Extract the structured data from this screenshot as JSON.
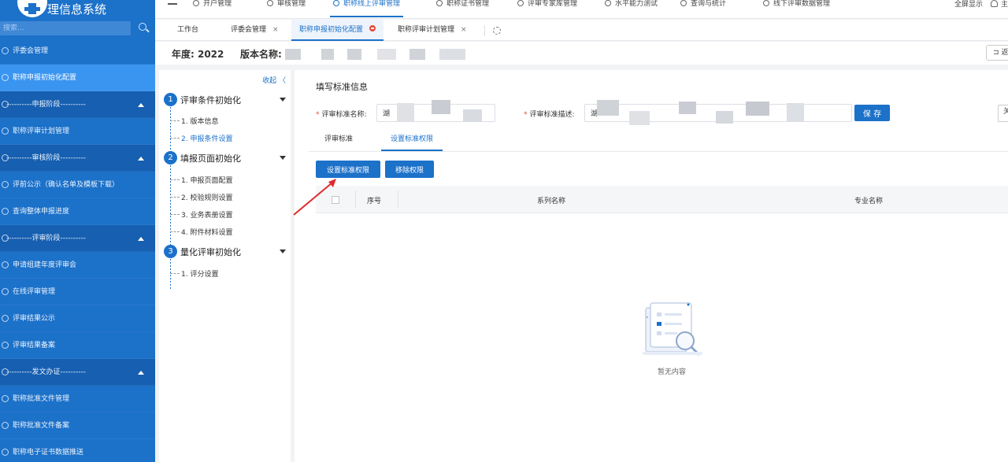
{
  "app": {
    "title": "理信息系统"
  },
  "sidebar": {
    "search_placeholder": "搜索...",
    "items": [
      {
        "label": "评委会管理",
        "type": "item",
        "active": false
      },
      {
        "label": "职称申报初始化配置",
        "type": "item",
        "active": true
      },
      {
        "label": "----------申报阶段----------",
        "type": "group"
      },
      {
        "label": "职称评审计划管理",
        "type": "item",
        "active": false
      },
      {
        "label": "----------审核阶段----------",
        "type": "group"
      },
      {
        "label": "评前公示（确认名单及模板下载）",
        "type": "item",
        "active": false
      },
      {
        "label": "查询整体申报进度",
        "type": "item",
        "active": false
      },
      {
        "label": "----------评审阶段----------",
        "type": "group"
      },
      {
        "label": "申请组建年度评审会",
        "type": "item",
        "active": false
      },
      {
        "label": "在线评审管理",
        "type": "item",
        "active": false
      },
      {
        "label": "评审结果公示",
        "type": "item",
        "active": false
      },
      {
        "label": "评审结果备案",
        "type": "item",
        "active": false
      },
      {
        "label": "----------发文办证----------",
        "type": "group"
      },
      {
        "label": "职称批准文件管理",
        "type": "item",
        "active": false
      },
      {
        "label": "职称批准文件备案",
        "type": "item",
        "active": false
      },
      {
        "label": "职称电子证书数据推送",
        "type": "item",
        "active": false
      }
    ]
  },
  "topnav": {
    "items": [
      {
        "label": "开户管理",
        "active": false
      },
      {
        "label": "审核管理",
        "active": false
      },
      {
        "label": "职称线上评审管理",
        "active": true
      },
      {
        "label": "职称证书管理",
        "active": false
      },
      {
        "label": "评审专家库管理",
        "active": false
      },
      {
        "label": "水平能力测试",
        "active": false
      },
      {
        "label": "查询与统计",
        "active": false
      },
      {
        "label": "线下评审数据管理",
        "active": false
      }
    ],
    "fullscreen_label": "全屏显示",
    "user_label": "主"
  },
  "tabs": [
    {
      "label": "工作台",
      "closable": false,
      "active": false
    },
    {
      "label": "评委会管理",
      "closable": true,
      "active": false
    },
    {
      "label": "职称申报初始化配置",
      "closable": true,
      "active": true
    },
    {
      "label": "职称评审计划管理",
      "closable": true,
      "active": false
    }
  ],
  "tab_close_glyph": "×",
  "header": {
    "year_text": "年度: 2022",
    "version_label": "版本名称:",
    "back_label": "返"
  },
  "steps": {
    "collapse_label": "收起 〈",
    "groups": [
      {
        "num": "1",
        "title": "评审条件初始化",
        "items": [
          {
            "label": "1. 版本信息",
            "active": false
          },
          {
            "label": "2. 申报条件设置",
            "active": true
          }
        ]
      },
      {
        "num": "2",
        "title": "填报页面初始化",
        "items": [
          {
            "label": "1. 申报页面配置",
            "active": false
          },
          {
            "label": "2. 校验规则设置",
            "active": false
          },
          {
            "label": "3. 业务表册设置",
            "active": false
          },
          {
            "label": "4. 附件材料设置",
            "active": false
          }
        ]
      },
      {
        "num": "3",
        "title": "量化评审初始化",
        "items": [
          {
            "label": "1. 评分设置",
            "active": false
          }
        ]
      }
    ]
  },
  "main": {
    "section_title": "填写标准信息",
    "required_mark": "*",
    "name_label": "评审标准名称:",
    "name_value": "湖",
    "desc_label": "评审标准描述:",
    "desc_value": "湖",
    "save_label": "保 存",
    "edge_label": "关",
    "inner_tabs": [
      {
        "label": "评审标准",
        "active": false
      },
      {
        "label": "设置标准权限",
        "active": true
      }
    ],
    "buttons": {
      "set_permission": "设置标准权限",
      "remove_permission": "移除权限"
    },
    "table": {
      "columns": [
        "序号",
        "系列名称",
        "专业名称"
      ]
    },
    "empty_text": "暂无内容"
  },
  "colors": {
    "primary": "#1c71c9",
    "sidebar_bg": "#1c71c9",
    "active_item": "#3a95f0",
    "danger": "#e74c3c"
  }
}
